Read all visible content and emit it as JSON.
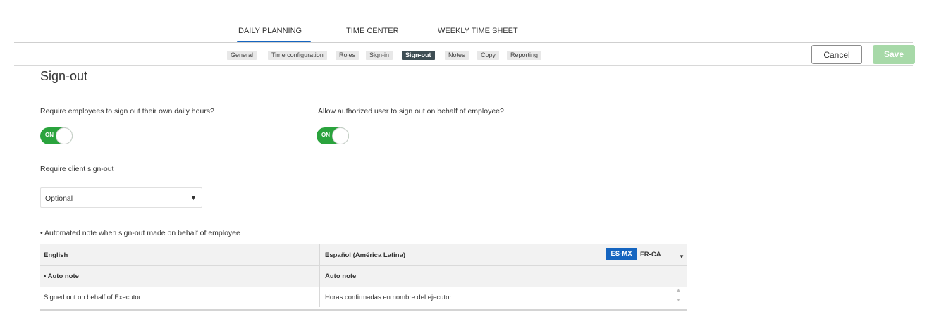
{
  "tabs": {
    "daily_planning": "DAILY PLANNING",
    "time_center": "TIME CENTER",
    "weekly_time_sheet": "WEEKLY TIME SHEET"
  },
  "subnav": {
    "general": "General",
    "time_configuration": "Time configuration",
    "roles": "Roles",
    "sign_in": "Sign-in",
    "sign_out": "Sign-out",
    "notes": "Notes",
    "copy": "Copy",
    "reporting": "Reporting"
  },
  "actions": {
    "cancel": "Cancel",
    "save": "Save"
  },
  "page": {
    "title": "Sign-out"
  },
  "settings": {
    "require_employees_label": "Require employees to sign out their own daily hours?",
    "require_employees_toggle": "ON",
    "allow_authorized_label": "Allow authorized user to sign out on behalf of employee?",
    "allow_authorized_toggle": "ON",
    "require_client_label": "Require client sign-out",
    "require_client_value": "Optional"
  },
  "notes_table": {
    "label": "• Automated note when sign-out made on behalf of employee",
    "col_english": "English",
    "col_spanish": "Español (América Latina)",
    "lang_active": "ES-MX",
    "lang_other": "FR-CA",
    "sub_english": "• Auto note",
    "sub_spanish": "Auto note",
    "row_english": "Signed out on behalf of Executor",
    "row_spanish": "Horas confirmadas en nombre del ejecutor"
  },
  "colors": {
    "accent": "#1565c0",
    "toggle_on": "#2aa33d",
    "save_disabled": "#a7d9a8",
    "active_pill": "#3f4e54"
  }
}
